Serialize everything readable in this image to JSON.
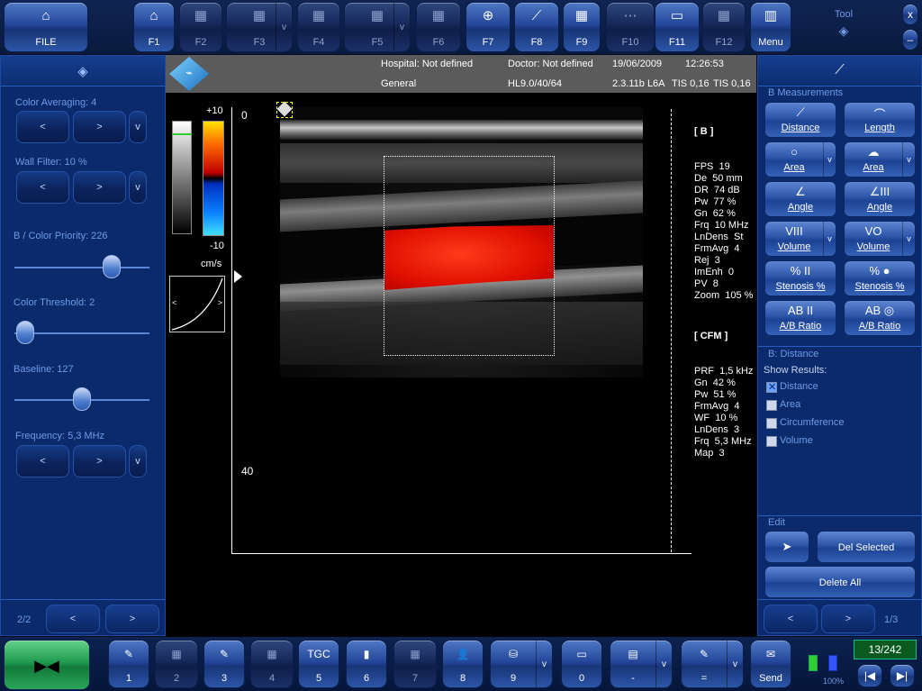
{
  "top": {
    "file_label": "FILE",
    "fkeys": [
      "F1",
      "F2",
      "F3",
      "F4",
      "F5",
      "F6",
      "F7",
      "F8",
      "F9",
      "F10",
      "F11",
      "F12"
    ],
    "menu_label": "Menu",
    "tool_label": "Tool",
    "close_glyph": "x",
    "min_glyph": "–",
    "dropdown_glyph": "v"
  },
  "info": {
    "hospital": "Hospital: Not defined",
    "doctor": "Doctor: Not defined",
    "date": "19/06/2009",
    "time": "12:26:53",
    "exam": "General",
    "probe": "HL9.0/40/64",
    "version": "2.3.11b L6A",
    "tis1": "TIS 0,16",
    "tis2": "TIS 0,16"
  },
  "left": {
    "color_averaging": "Color Averaging: 4",
    "wall_filter": "Wall Filter: 10 %",
    "b_color_priority": "B / Color Priority: 226",
    "color_threshold": "Color Threshold: 2",
    "baseline": "Baseline: 127",
    "frequency": "Frequency: 5,3 MHz",
    "prev": "<",
    "next": ">",
    "more": "v",
    "page": "2/2",
    "slider_levels": {
      "b_color_priority": 0.72,
      "color_threshold": 0.08,
      "baseline": 0.5
    }
  },
  "scale": {
    "plus": "+10",
    "minus": "-10",
    "unit": "cm/s",
    "depth_top": "0",
    "depth_bottom": "40",
    "curve_left": "<",
    "curve_right": ">"
  },
  "params": {
    "b_header": "[ B ]",
    "b_lines": [
      "FPS  19",
      "De  50 mm",
      "DR  74 dB",
      "Pw  77 %",
      "Gn  62 %",
      "Frq  10 MHz",
      "LnDens  St",
      "FrmAvg  4",
      "Rej  3",
      "ImEnh  0",
      "PV  8",
      "Zoom  105 %"
    ],
    "cfm_header": "[ CFM ]",
    "cfm_lines": [
      "PRF  1,5 kHz",
      "Gn  42 %",
      "Pw  51 %",
      "FrmAvg  4",
      "WF  10 %",
      "LnDens  3",
      "Frq  5,3 MHz",
      "Map  3"
    ]
  },
  "right": {
    "section_title": "B Measurements",
    "measure_buttons": [
      {
        "label": "Distance",
        "icon": "⟋",
        "arrow": ""
      },
      {
        "label": "Length",
        "icon": "⌒",
        "arrow": ""
      },
      {
        "label": "Area",
        "icon": "○",
        "arrow": "v"
      },
      {
        "label": "Area",
        "icon": "☁",
        "arrow": "v"
      },
      {
        "label": "Angle",
        "icon": "∠",
        "arrow": ""
      },
      {
        "label": "Angle",
        "icon": "∠III",
        "arrow": ""
      },
      {
        "label": "Volume",
        "icon": "VIII",
        "arrow": "v"
      },
      {
        "label": "Volume",
        "icon": "VO",
        "arrow": "v"
      },
      {
        "label": "Stenosis %",
        "icon": "% II",
        "arrow": ""
      },
      {
        "label": "Stenosis %",
        "icon": "% ●",
        "arrow": ""
      },
      {
        "label": "A/B Ratio",
        "icon": "AB II",
        "arrow": ""
      },
      {
        "label": "A/B Ratio",
        "icon": "AB ◎",
        "arrow": ""
      }
    ],
    "distance_title": "B: Distance",
    "show_results": "Show Results:",
    "results": [
      {
        "label": "Distance",
        "checked": true
      },
      {
        "label": "Area",
        "checked": false
      },
      {
        "label": "Circumference",
        "checked": false
      },
      {
        "label": "Volume",
        "checked": false
      }
    ],
    "edit_title": "Edit",
    "del_selected": "Del Selected",
    "delete_all": "Delete All",
    "prev": "<",
    "next": ">",
    "page": "1/3"
  },
  "bottom": {
    "buttons": [
      {
        "label": "1",
        "icon": "✎",
        "arrow": "",
        "dim": false
      },
      {
        "label": "2",
        "icon": "▦",
        "arrow": "",
        "dim": true
      },
      {
        "label": "3",
        "icon": "✎",
        "arrow": "",
        "dim": false
      },
      {
        "label": "4",
        "icon": "▦",
        "arrow": "",
        "dim": true
      },
      {
        "label": "5",
        "icon": "TGC",
        "arrow": "",
        "dim": false
      },
      {
        "label": "6",
        "icon": "▮",
        "arrow": "",
        "dim": false
      },
      {
        "label": "7",
        "icon": "▦",
        "arrow": "",
        "dim": true
      },
      {
        "label": "8",
        "icon": "👤",
        "arrow": "",
        "dim": false
      },
      {
        "label": "9",
        "icon": "⛁",
        "arrow": "v",
        "dim": false
      },
      {
        "label": "0",
        "icon": "▭",
        "arrow": "",
        "dim": false
      },
      {
        "label": "-",
        "icon": "▤",
        "arrow": "v",
        "dim": false
      },
      {
        "label": "=",
        "icon": "✎",
        "arrow": "v",
        "dim": false
      },
      {
        "label": "Send",
        "icon": "✉",
        "arrow": "",
        "dim": false
      }
    ],
    "battery": "100%",
    "frame_counter": "13/242"
  },
  "colors": {
    "accent": "#6f9be6",
    "panel": "#0a2a6b",
    "flow": "#ff1a00"
  }
}
